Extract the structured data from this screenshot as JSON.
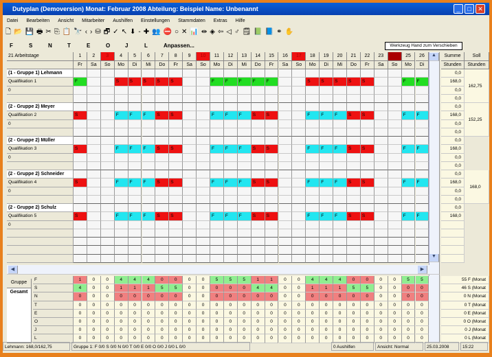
{
  "window": {
    "title": "Dutyplan (Demoversion)  Monat: Februar 2008  Abteilung: Beispiel  Name: Unbenannt",
    "min": "_",
    "max": "□",
    "close": "✕"
  },
  "menu": [
    "Datei",
    "Bearbeiten",
    "Ansicht",
    "Mitarbeiter",
    "Aushilfen",
    "Einstellungen",
    "Stammdaten",
    "Extras",
    "Hilfe"
  ],
  "toolbar_icons": [
    "new-icon",
    "open-icon",
    "save-icon",
    "print-icon",
    "cut-icon",
    "copy-icon",
    "paste-icon",
    "find-icon",
    "undo-icon",
    "redo-icon",
    "database-icon",
    "window-icon",
    "check-icon",
    "pointer-icon",
    "arrow-down-icon",
    "dash-icon",
    "plus-icon",
    "users-icon",
    "stop-icon",
    "circle-icon",
    "close-x-icon",
    "chart-icon",
    "resize-icon",
    "left-icon",
    "back-icon",
    "prev-icon",
    "next-icon",
    "note-icon",
    "book-icon",
    "book2-icon",
    "link-icon",
    "hand-icon"
  ],
  "toolbar_glyphs": [
    "🗋",
    "📂",
    "💾",
    "🖶",
    "✂",
    "⎘",
    "📋",
    "🔭",
    "‹",
    "›",
    "⛁",
    "🗗",
    "✓",
    "↖",
    "⬇",
    "-",
    "✚",
    "👥",
    "⛔",
    "○",
    "✕",
    "📊",
    "⇹",
    "◈",
    "⇦",
    "◁",
    "♂",
    "🗒",
    "📗",
    "📘",
    "⚭",
    "✋"
  ],
  "shift_letters": [
    "F",
    "S",
    "N",
    "T",
    "E",
    "O",
    "J",
    "L"
  ],
  "adjust_label": "Anpassen...",
  "tooltip": "Werkzeug Hand zum Verschieben",
  "workdays_label": "21 Arbeitstage",
  "sum_header": [
    "Summe",
    "Stunden"
  ],
  "soll_header": [
    "Soll",
    "Stunden"
  ],
  "days": [
    1,
    2,
    3,
    4,
    5,
    6,
    7,
    8,
    9,
    10,
    11,
    12,
    13,
    14,
    15,
    16,
    17,
    18,
    19,
    20,
    21,
    22,
    23,
    24,
    25,
    26
  ],
  "weekdays": [
    "Fr",
    "Sa",
    "So",
    "Mo",
    "Di",
    "Mi",
    "Do",
    "Fr",
    "Sa",
    "So",
    "Mo",
    "Di",
    "Mi",
    "Do",
    "Fr",
    "Sa",
    "So",
    "Mo",
    "Di",
    "Mi",
    "Do",
    "Fr",
    "Sa",
    "So",
    "Mo",
    "Di"
  ],
  "holidays": [
    3,
    10,
    17,
    24
  ],
  "colors": {
    "F_green": "#22dd22",
    "F_cyan": "#22e6f0",
    "S_red": "#ee1111",
    "stat_green": "#90ee90",
    "stat_red": "#f08080",
    "header_red": "#ee1111"
  },
  "groups": [
    {
      "name": "(1 - Gruppe 1) Lehmann",
      "qual": "Qualifikation 1",
      "sub": "0",
      "fcolor": "green",
      "shifts": [
        "F",
        "",
        "",
        "S",
        "S",
        "S",
        "S",
        "S",
        "",
        "",
        "F",
        "F",
        "F",
        "F",
        "F",
        "",
        "",
        "S",
        "S",
        "S",
        "S",
        "S",
        "",
        "",
        "F",
        "F"
      ],
      "sums": [
        "0,0",
        "168,0",
        "0,0",
        "0,0"
      ],
      "soll": "162,75"
    },
    {
      "name": "(2 - Gruppe 2) Meyer",
      "qual": "Qualifikation 2",
      "sub": "0",
      "fcolor": "cyan",
      "shifts": [
        "S",
        "",
        "",
        "F",
        "F",
        "F",
        "S",
        "S",
        "",
        "",
        "F",
        "F",
        "F",
        "S",
        "S",
        "",
        "",
        "F",
        "F",
        "F",
        "S",
        "S",
        "",
        "",
        "F",
        "F"
      ],
      "sums": [
        "0,0",
        "168,0",
        "0,0",
        "0,0"
      ],
      "soll": "152,25"
    },
    {
      "name": "(2 - Gruppe 2) Müller",
      "qual": "Qualifikation 3",
      "sub": "0",
      "fcolor": "cyan",
      "shifts": [
        "S",
        "",
        "",
        "F",
        "F",
        "F",
        "S",
        "S",
        "",
        "",
        "F",
        "F",
        "F",
        "S",
        "S",
        "",
        "",
        "F",
        "F",
        "F",
        "S",
        "S",
        "",
        "",
        "F",
        "F"
      ],
      "sums": [
        "0,0",
        "168,0",
        "0,0",
        "0,0"
      ],
      "soll": ""
    },
    {
      "name": "(2 - Gruppe 2) Schneider",
      "qual": "Qualifikation 4",
      "sub": "0",
      "fcolor": "cyan",
      "shifts": [
        "S",
        "",
        "",
        "F",
        "F",
        "F",
        "S",
        "S",
        "",
        "",
        "F",
        "F",
        "F",
        "S",
        "S",
        "",
        "",
        "F",
        "F",
        "F",
        "S",
        "S",
        "",
        "",
        "F",
        "F"
      ],
      "sums": [
        "0,0",
        "168,0",
        "0,0",
        "0,0"
      ],
      "soll": "168,0"
    },
    {
      "name": "(2 - Gruppe 2) Schulz",
      "qual": "Qualifikation 5",
      "sub": "0",
      "fcolor": "cyan",
      "shifts": [
        "S",
        "",
        "",
        "F",
        "F",
        "F",
        "S",
        "S",
        "",
        "",
        "F",
        "F",
        "F",
        "S",
        "S",
        "",
        "",
        "F",
        "F",
        "F",
        "S",
        "S",
        "",
        "",
        "F",
        "F"
      ],
      "sums": [
        "0,0",
        "168,0"
      ],
      "soll": ""
    }
  ],
  "stats_tabs": [
    "Gruppe",
    "Gesamt"
  ],
  "stats": [
    {
      "label": "F",
      "values": [
        1,
        0,
        0,
        4,
        4,
        4,
        0,
        0,
        0,
        0,
        5,
        5,
        5,
        1,
        1,
        0,
        0,
        4,
        4,
        4,
        0,
        0,
        0,
        0,
        5,
        5
      ],
      "month": "55 F (Monat"
    },
    {
      "label": "S",
      "values": [
        4,
        0,
        0,
        1,
        1,
        1,
        5,
        5,
        0,
        0,
        0,
        0,
        0,
        4,
        4,
        0,
        0,
        1,
        1,
        1,
        5,
        5,
        0,
        0,
        0,
        0
      ],
      "month": "46 S (Monat"
    },
    {
      "label": "N",
      "values": [
        0,
        0,
        0,
        0,
        0,
        0,
        0,
        0,
        0,
        0,
        0,
        0,
        0,
        0,
        0,
        0,
        0,
        0,
        0,
        0,
        0,
        0,
        0,
        0,
        0,
        0
      ],
      "month": "0 N (Monat"
    },
    {
      "label": "T",
      "values": [
        0,
        0,
        0,
        0,
        0,
        0,
        0,
        0,
        0,
        0,
        0,
        0,
        0,
        0,
        0,
        0,
        0,
        0,
        0,
        0,
        0,
        0,
        0,
        0,
        0,
        0
      ],
      "month": "0 T (Monat"
    },
    {
      "label": "E",
      "values": [
        0,
        0,
        0,
        0,
        0,
        0,
        0,
        0,
        0,
        0,
        0,
        0,
        0,
        0,
        0,
        0,
        0,
        0,
        0,
        0,
        0,
        0,
        0,
        0,
        0,
        0
      ],
      "month": "0 E (Monat"
    },
    {
      "label": "O",
      "values": [
        0,
        0,
        0,
        0,
        0,
        0,
        0,
        0,
        0,
        0,
        0,
        0,
        0,
        0,
        0,
        0,
        0,
        0,
        0,
        0,
        0,
        0,
        0,
        0,
        0,
        0
      ],
      "month": "0 O (Monat"
    },
    {
      "label": "J",
      "values": [
        0,
        0,
        0,
        0,
        0,
        0,
        0,
        0,
        0,
        0,
        0,
        0,
        0,
        0,
        0,
        0,
        0,
        0,
        0,
        0,
        0,
        0,
        0,
        0,
        0,
        0
      ],
      "month": "0 J (Monat"
    },
    {
      "label": "L",
      "values": [
        0,
        0,
        0,
        0,
        0,
        0,
        0,
        0,
        0,
        0,
        0,
        0,
        0,
        0,
        0,
        0,
        0,
        0,
        0,
        0,
        0,
        0,
        0,
        0,
        0,
        0
      ],
      "month": "0 L (Monat"
    }
  ],
  "status": {
    "employee": "Lehmann: 168,0/162,75",
    "group": "Gruppe 1:   F 0/0   S 0/0   N 0/0   T 0/0   E 0/0   O 0/0   J 0/0   L 0/0",
    "aushilfen": "0 Aushilfen",
    "view": "Ansicht: Normal",
    "date": "25.03.2008",
    "time": "15:22"
  }
}
